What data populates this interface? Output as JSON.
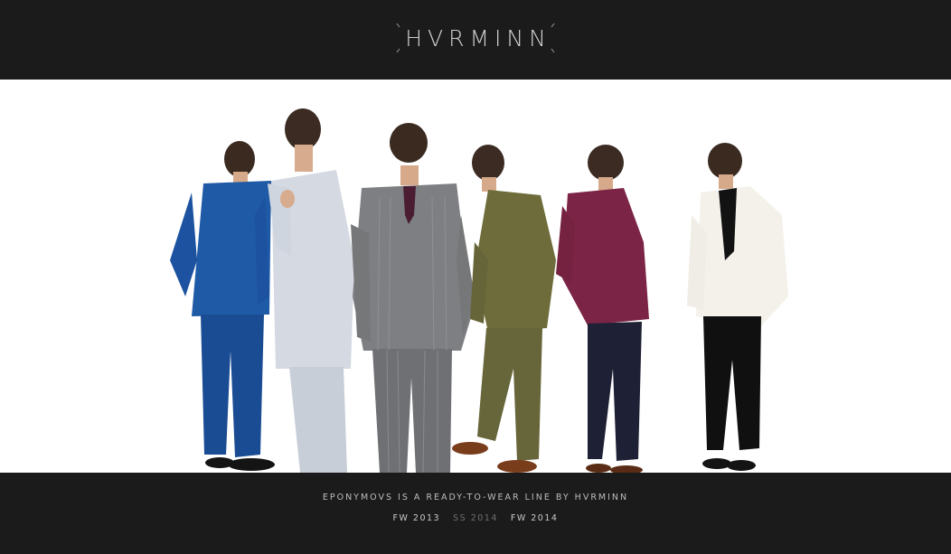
{
  "brand": {
    "logo_text": "HVRMINN"
  },
  "hero": {
    "image_alt": "Six models wearing suits from the Eponymous collection",
    "models": [
      "model-blue-suit",
      "model-light-blue-suit",
      "model-grey-pinstripe-suit",
      "model-olive-suit",
      "model-burgundy-jacket",
      "model-white-jacket"
    ]
  },
  "footer": {
    "tagline": "EPONYMOVS IS A READY-TO-WEAR LINE BY HVRMINN",
    "collections": [
      {
        "label": "FW 2013",
        "active": true
      },
      {
        "label": "SS 2014",
        "active": false
      },
      {
        "label": "FW 2014",
        "active": true
      }
    ]
  },
  "colors": {
    "background": "#1b1b1b",
    "hero_background": "#ffffff",
    "text_light": "#c9c9c9",
    "text_dim": "#6e6e6e"
  }
}
